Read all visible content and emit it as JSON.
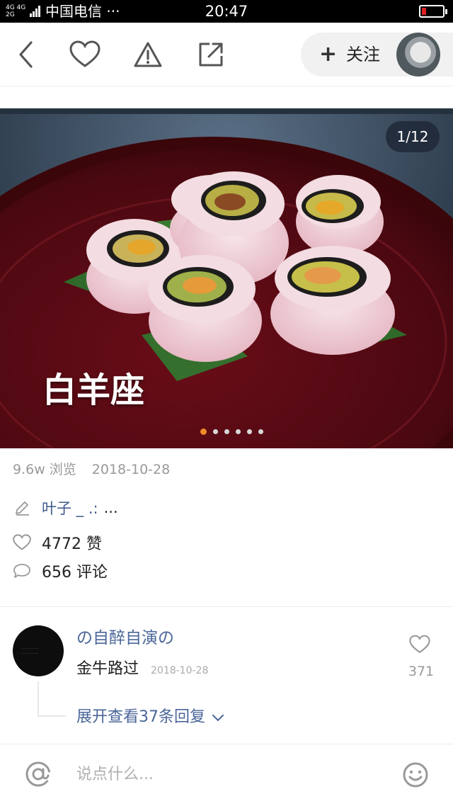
{
  "status_bar": {
    "network": "4G 4G",
    "network2": "2G",
    "carrier": "中国电信 ···",
    "time": "20:47"
  },
  "nav": {
    "follow_label": "关注",
    "follow_plus": "+"
  },
  "banner": {
    "counter": "1/12",
    "caption": "白羊座",
    "page_count": 6,
    "active_page": 0
  },
  "post_meta": {
    "views": "9.6w 浏览",
    "date": "2018-10-28"
  },
  "author": {
    "name": "叶子 _ .:",
    "more": "..."
  },
  "stats": {
    "likes": "4772 赞",
    "comments": "656 评论"
  },
  "comment": {
    "username": "の自醉自演の",
    "text": "金牛路过",
    "date": "2018-10-28",
    "like_count": "371",
    "expand_label": "展开查看37条回复"
  },
  "input_bar": {
    "placeholder": "说点什么..."
  },
  "colors": {
    "link_blue": "#4a6699",
    "dot_active": "#f08c2a",
    "battery_low": "#e02020"
  }
}
